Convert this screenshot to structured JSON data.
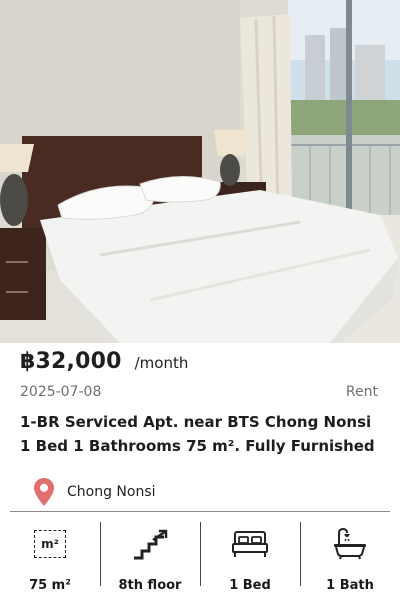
{
  "listing": {
    "price": "฿32,000",
    "period": "/month",
    "date": "2025-07-08",
    "type": "Rent",
    "title": "1-BR Serviced Apt. near BTS Chong Nonsi 1 Bed 1 Bathrooms 75 m². Fully Furnished",
    "location": "Chong Nonsi",
    "photo_icon": "bedroom-photo"
  },
  "features": [
    {
      "icon": "area-icon",
      "icon_text": "m²",
      "label": "75 m²"
    },
    {
      "icon": "stairs-icon",
      "label": "8th floor"
    },
    {
      "icon": "bed-icon",
      "label": "1 Bed"
    },
    {
      "icon": "bathtub-icon",
      "label": "1 Bath"
    }
  ],
  "colors": {
    "pin": "#e07070",
    "text": "#1f1f1f",
    "muted": "#6f6f6f"
  }
}
